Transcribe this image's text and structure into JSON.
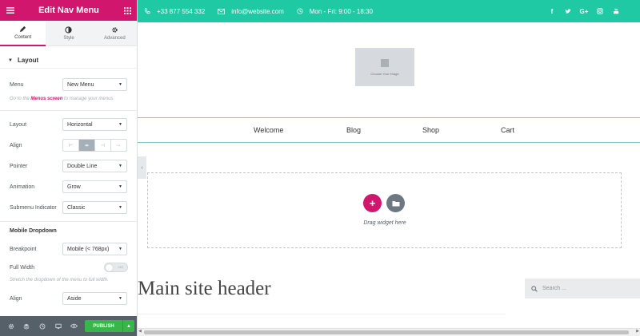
{
  "panel": {
    "title": "Edit Nav Menu",
    "tabs": [
      {
        "label": "Content",
        "icon": "pencil-icon"
      },
      {
        "label": "Style",
        "icon": "contrast-icon"
      },
      {
        "label": "Advanced",
        "icon": "gear-icon"
      }
    ],
    "section": {
      "label": "Layout"
    },
    "menu": {
      "label": "Menu",
      "value": "New Menu"
    },
    "note": {
      "prefix": "Go to the ",
      "link": "Menus screen",
      "suffix": " to manage your menus."
    },
    "layout": {
      "label": "Layout",
      "value": "Horizontal"
    },
    "align": {
      "label": "Align",
      "options": [
        "left",
        "center",
        "right",
        "justify"
      ],
      "selected": "center"
    },
    "pointer": {
      "label": "Pointer",
      "value": "Double Line"
    },
    "animation": {
      "label": "Animation",
      "value": "Grow"
    },
    "submenu_indicator": {
      "label": "Submenu Indicator",
      "value": "Classic"
    },
    "mobile_dropdown": {
      "label": "Mobile Dropdown"
    },
    "breakpoint": {
      "label": "Breakpoint",
      "value": "Mobile (< 768px)"
    },
    "full_width": {
      "label": "Full Width",
      "toggle_text": "NO",
      "note": "Stretch the dropdown of the menu to full width."
    },
    "align2": {
      "label": "Align",
      "value": "Aside"
    },
    "footer": {
      "publish_label": "PUBLISH"
    }
  },
  "preview": {
    "topbar": {
      "phone": "+33 877 554 332",
      "email": "info@website.com",
      "hours": "Mon - Fri: 9:00 - 18:30",
      "social": [
        "f",
        "t",
        "G+",
        "ig",
        "yt"
      ]
    },
    "logo_placeholder": "Choose Your Image",
    "nav": [
      "Welcome",
      "Blog",
      "Shop",
      "Cart"
    ],
    "drag_text": "Drag widget here",
    "site_header": "Main site header",
    "search_placeholder": "Search ...",
    "colors": {
      "accent": "#d1166d",
      "topbar": "#1ec9a4",
      "publish": "#39b54a",
      "footer": "#556068"
    }
  }
}
